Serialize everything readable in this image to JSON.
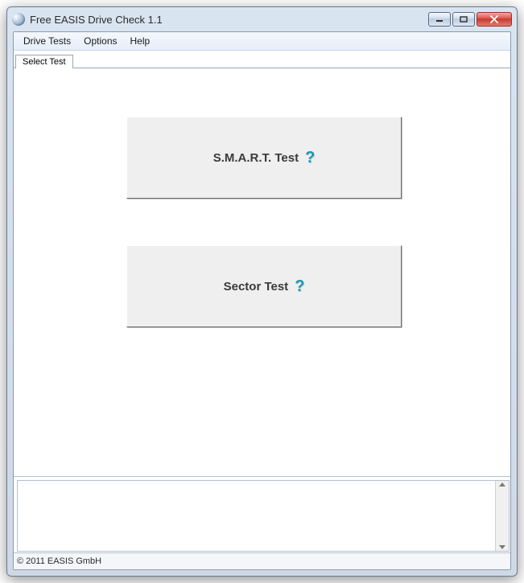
{
  "window": {
    "title": "Free EASIS Drive Check 1.1"
  },
  "menu": {
    "items": [
      "Drive Tests",
      "Options",
      "Help"
    ]
  },
  "tabs": {
    "selected": "Select Test"
  },
  "buttons": {
    "smart_label": "S.M.A.R.T. Test",
    "sector_label": "Sector Test",
    "help_glyph": "?"
  },
  "status": {
    "copyright": "© 2011 EASIS GmbH"
  }
}
